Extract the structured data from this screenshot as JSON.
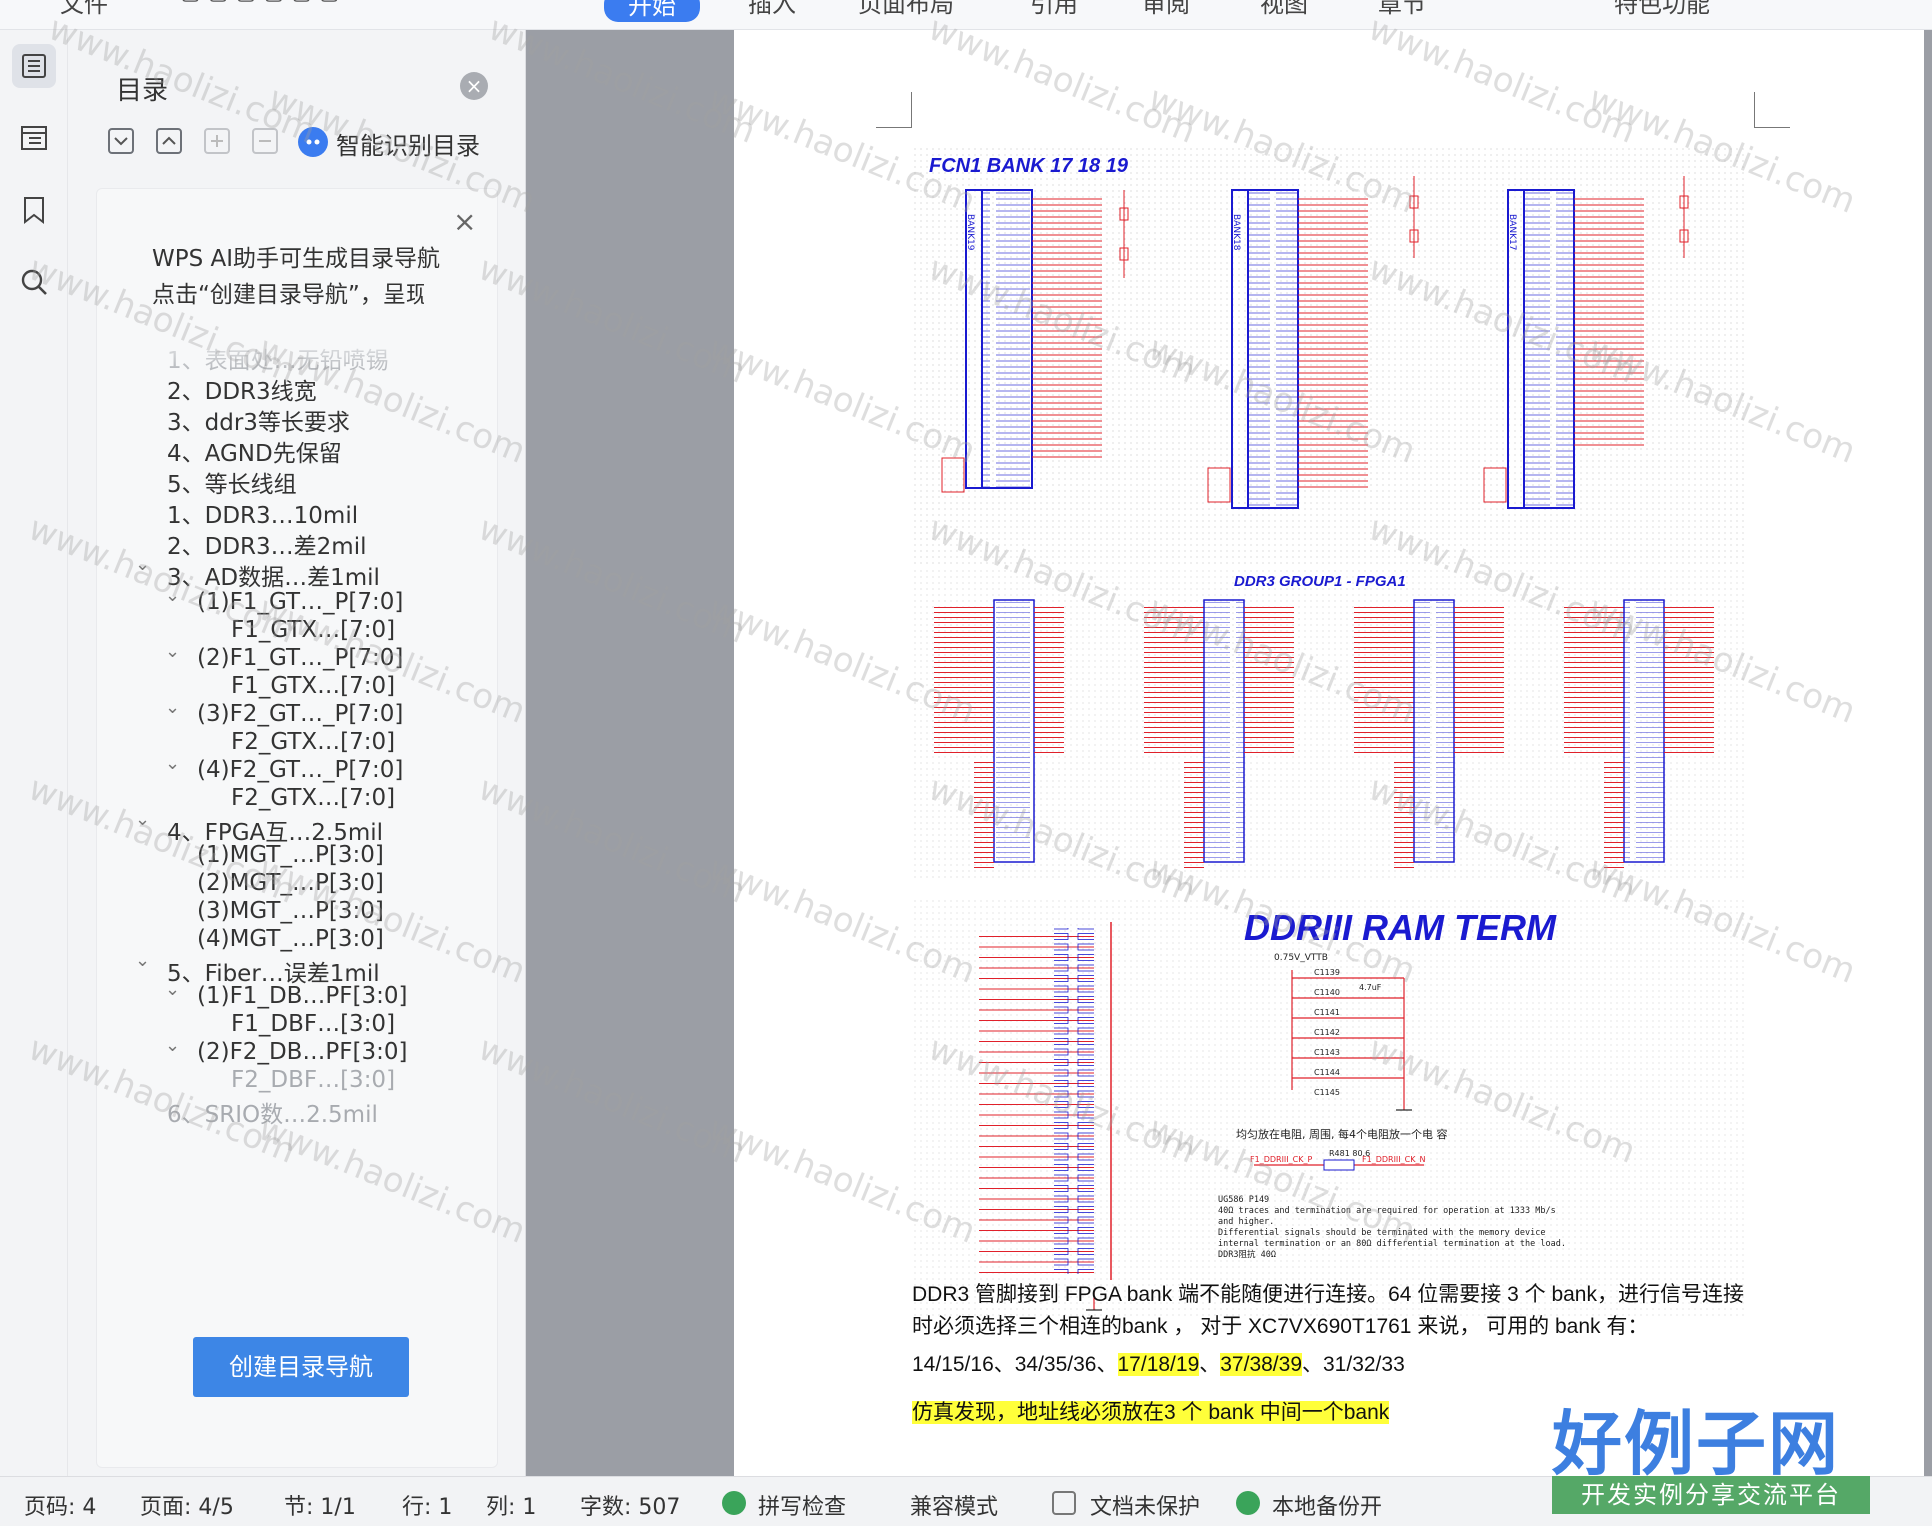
{
  "ribbon": {
    "tabs": [
      "文件",
      "开始",
      "插入",
      "页面布局",
      "引用",
      "审阅",
      "视图",
      "章节",
      "特色功能"
    ],
    "active_tab": "开始"
  },
  "toc": {
    "title": "目录",
    "smart_label": "智能识别目录",
    "ai_line1": "WPS AI助手可生成目录导航",
    "ai_line2": "点击“创建目录导航”，呈现文档",
    "create_button": "创建目录导航",
    "items": [
      {
        "label": "1、表面处…无铅喷锡",
        "level": 0,
        "faded": true,
        "chevron": false
      },
      {
        "label": "2、DDR3线宽",
        "level": 0,
        "faded": false,
        "chevron": false
      },
      {
        "label": "3、ddr3等长要求",
        "level": 0,
        "faded": false,
        "chevron": false
      },
      {
        "label": "4、AGND先保留",
        "level": 0,
        "faded": false,
        "chevron": false
      },
      {
        "label": "5、等长线组",
        "level": 0,
        "faded": false,
        "chevron": false
      },
      {
        "label": "1、DDR3…10mil",
        "level": 0,
        "faded": false,
        "chevron": false
      },
      {
        "label": "2、DDR3…差2mil",
        "level": 0,
        "faded": false,
        "chevron": false
      },
      {
        "label": "3、AD数据…差1mil",
        "level": 0,
        "faded": false,
        "chevron": true
      },
      {
        "label": "(1)F1_GT…_P[7:0]",
        "level": 1,
        "faded": false,
        "chevron": true
      },
      {
        "label": "F1_GTX…[7:0]",
        "level": 2,
        "faded": false,
        "chevron": false
      },
      {
        "label": "(2)F1_GT…_P[7:0]",
        "level": 1,
        "faded": false,
        "chevron": true
      },
      {
        "label": "F1_GTX…[7:0]",
        "level": 2,
        "faded": false,
        "chevron": false
      },
      {
        "label": "(3)F2_GT…_P[7:0]",
        "level": 1,
        "faded": false,
        "chevron": true
      },
      {
        "label": "F2_GTX…[7:0]",
        "level": 2,
        "faded": false,
        "chevron": false
      },
      {
        "label": "(4)F2_GT…_P[7:0]",
        "level": 1,
        "faded": false,
        "chevron": true
      },
      {
        "label": "F2_GTX…[7:0]",
        "level": 2,
        "faded": false,
        "chevron": false
      },
      {
        "label": "4、FPGA互…2.5mil",
        "level": 0,
        "faded": false,
        "chevron": true
      },
      {
        "label": "(1)MGT_…P[3:0]",
        "level": 1,
        "faded": false,
        "chevron": false
      },
      {
        "label": "(2)MGT_…P[3:0]",
        "level": 1,
        "faded": false,
        "chevron": false
      },
      {
        "label": "(3)MGT_…P[3:0]",
        "level": 1,
        "faded": false,
        "chevron": false
      },
      {
        "label": "(4)MGT_…P[3:0]",
        "level": 1,
        "faded": false,
        "chevron": false
      },
      {
        "label": "5、Fiber…误差1mil",
        "level": 0,
        "faded": false,
        "chevron": true
      },
      {
        "label": "(1)F1_DB…PF[3:0]",
        "level": 1,
        "faded": false,
        "chevron": true
      },
      {
        "label": "F1_DBF…[3:0]",
        "level": 2,
        "faded": false,
        "chevron": false
      },
      {
        "label": "(2)F2_DB…PF[3:0]",
        "level": 1,
        "faded": false,
        "chevron": true
      },
      {
        "label": "F2_DBF…[3:0]",
        "level": 2,
        "faded": true,
        "chevron": false
      },
      {
        "label": "6、SRIO数…2.5mil",
        "level": 0,
        "faded": true,
        "chevron": false
      }
    ]
  },
  "document": {
    "fig1_title": "FCN1 BANK 17 18 19",
    "fig1_banks": [
      "BANK19",
      "BANK18",
      "BANK17"
    ],
    "fig2_title": "DDR3 GROUP1 - FPGA1",
    "fig3_title": "DDRIII  RAM TERM",
    "fig3_vtt": "0.75V_VTTB",
    "fig3_caps": [
      "C1139",
      "C1140",
      "C1141",
      "C1142",
      "C1143",
      "C1144",
      "C1145"
    ],
    "fig3_cap_value": "4.7uF",
    "fig3_note": "均匀放在电阻, 周围, 每4个电阻放一个电 容",
    "fig3_ck_res": "R481  80.6",
    "fig3_ck_p": "F1_DDRIII_CK_P",
    "fig3_ck_n": "F1_DDRIII_CK_N",
    "fig3_ug_ref": "UG586    P149",
    "fig3_ug1": "40Ω  traces  and  termination  are  required  for  operation  at  1333  Mb/s",
    "fig3_ug2": "and  higher.",
    "fig3_ug3": "Differential  signals  should  be  terminated  with  the  memory  device",
    "fig3_ug4": "internal    termination  or  an  80Ω  differential  termination  at  the  load.",
    "fig3_ug5": "DDR3阻抗   40Ω",
    "para1": "DDR3 管脚接到 FPGA bank 端不能随便进行连接。64 位需要接 3 个 bank，进行信号连接",
    "para2": "时必须选择三个相连的bank ，  对于 XC7VX690T1761 来说，  可用的 bank  有：",
    "para3_a": "14/15/16、34/35/36、",
    "para3_hl1": "17/18/19",
    "para3_b": "、",
    "para3_hl2": "37/38/39",
    "para3_c": "、31/32/33",
    "para4": "仿真发现，地址线必须放在3 个 bank 中间一个bank"
  },
  "status": {
    "page_code": "页码: 4",
    "page": "页面: 4/5",
    "section": "节: 1/1",
    "row": "行: 1",
    "col": "列: 1",
    "words": "字数: 507",
    "spell": "拼写检查",
    "compat": "兼容模式",
    "protect": "文档未保护",
    "backup": "本地备份开"
  },
  "watermark": {
    "logo_main": "好例子网",
    "logo_sub": "开发实例分享交流平台",
    "text": "www.haolizi.com"
  },
  "colors": {
    "accent": "#3b7cf0",
    "highlight": "#ffff3a",
    "schematic_red": "#e0202a",
    "schematic_blue": "#1a1ad0"
  }
}
